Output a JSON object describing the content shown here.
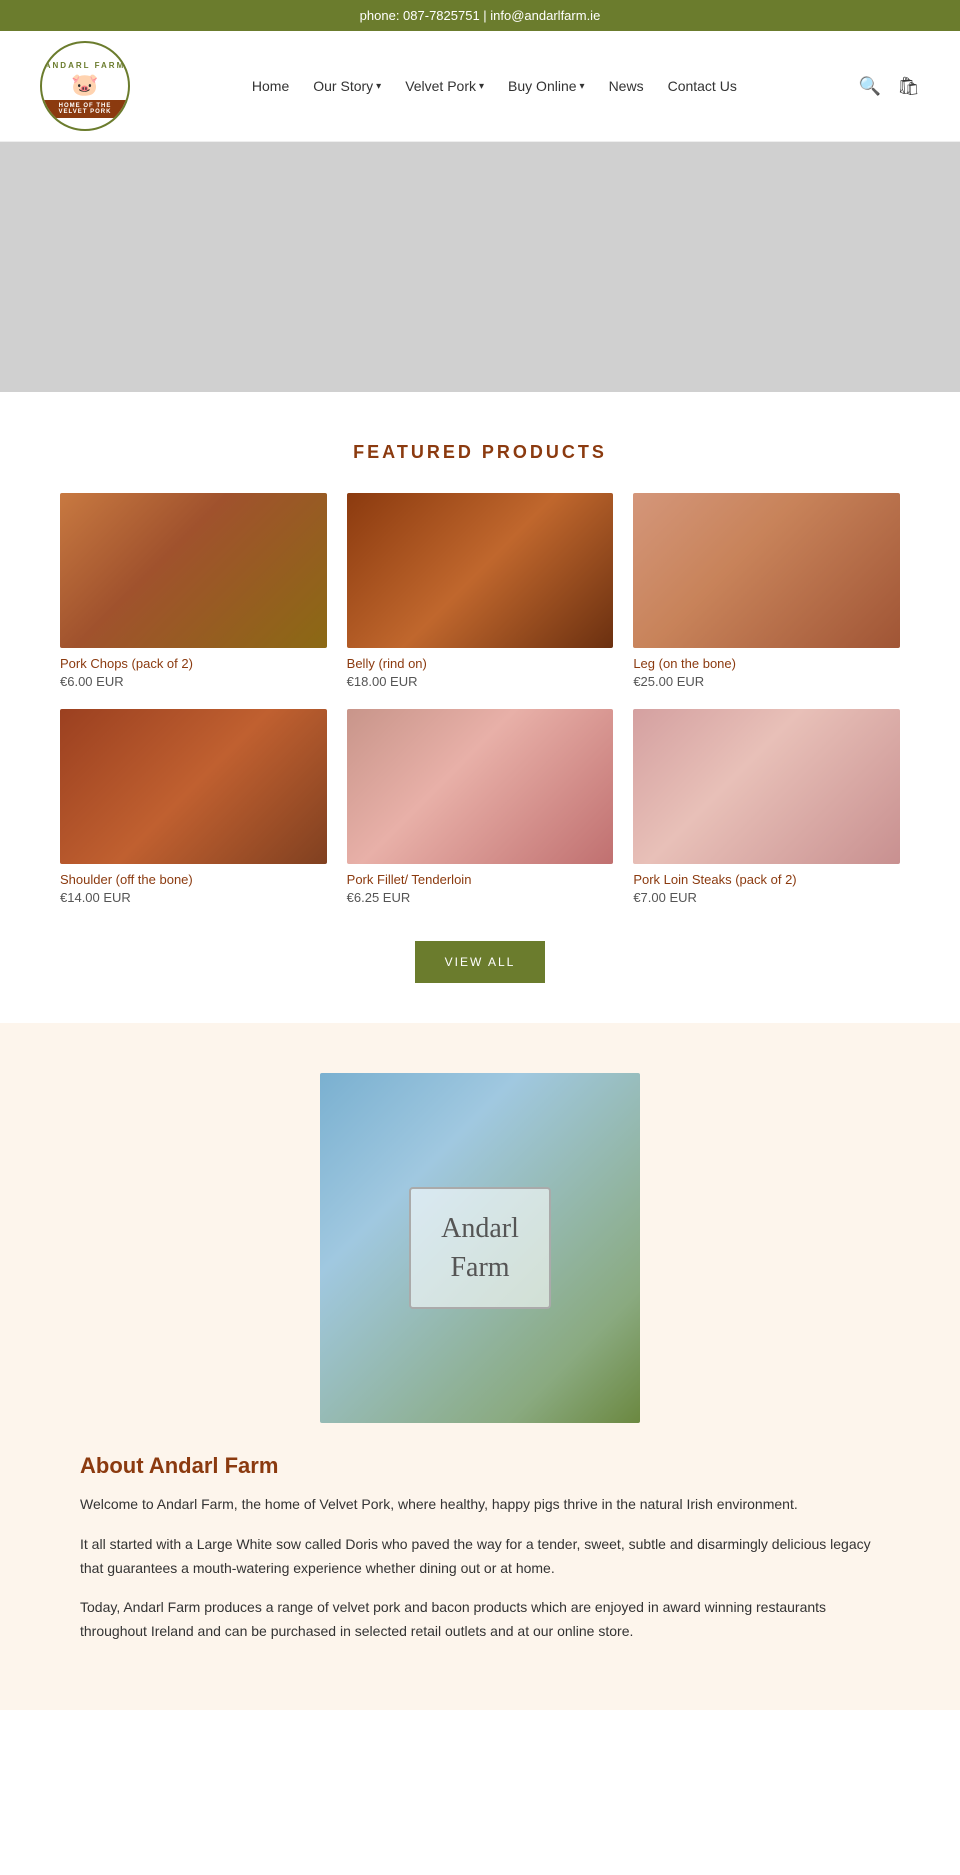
{
  "topbar": {
    "phone_label": "phone: 087-7825751 | info@andarlfarm.ie"
  },
  "header": {
    "logo": {
      "top_text": "ANDARL FARM",
      "pig_emoji": "🐖",
      "banner_text": "HOME OF THE VELVET PORK"
    },
    "nav": {
      "home": "Home",
      "our_story": "Our Story",
      "velvet_pork": "Velvet Pork",
      "buy_online": "Buy Online",
      "news": "News",
      "contact_us": "Contact Us"
    },
    "search_icon": "🔍",
    "cart_icon": "🛒"
  },
  "featured": {
    "title": "FEATURED PRODUCTS",
    "products": [
      {
        "name": "Pork Chops (pack of 2)",
        "price": "€6.00 EUR",
        "img_class": "img-pork-chops"
      },
      {
        "name": "Belly (rind on)",
        "price": "€18.00 EUR",
        "img_class": "img-belly"
      },
      {
        "name": "Leg (on the bone)",
        "price": "€25.00 EUR",
        "img_class": "img-leg"
      },
      {
        "name": "Shoulder (off the bone)",
        "price": "€14.00 EUR",
        "img_class": "img-shoulder"
      },
      {
        "name": "Pork Fillet/ Tenderloin",
        "price": "€6.25 EUR",
        "img_class": "img-fillet"
      },
      {
        "name": "Pork Loin Steaks (pack of 2)",
        "price": "€7.00 EUR",
        "img_class": "img-loin"
      }
    ],
    "view_all_btn": "VIEW\nALL"
  },
  "about": {
    "title": "About Andarl Farm",
    "paragraphs": [
      "Welcome to Andarl Farm, the home of Velvet Pork, where healthy, happy pigs thrive in the natural Irish environment.",
      "It all started with a Large White sow called Doris who paved the way for a tender, sweet, subtle and disarmingly delicious legacy that guarantees a mouth-watering experience whether dining out or at home.",
      "Today, Andarl Farm produces a range of velvet pork and bacon products which are enjoyed in award winning restaurants throughout Ireland and can be purchased in selected retail outlets and at our online store."
    ]
  }
}
